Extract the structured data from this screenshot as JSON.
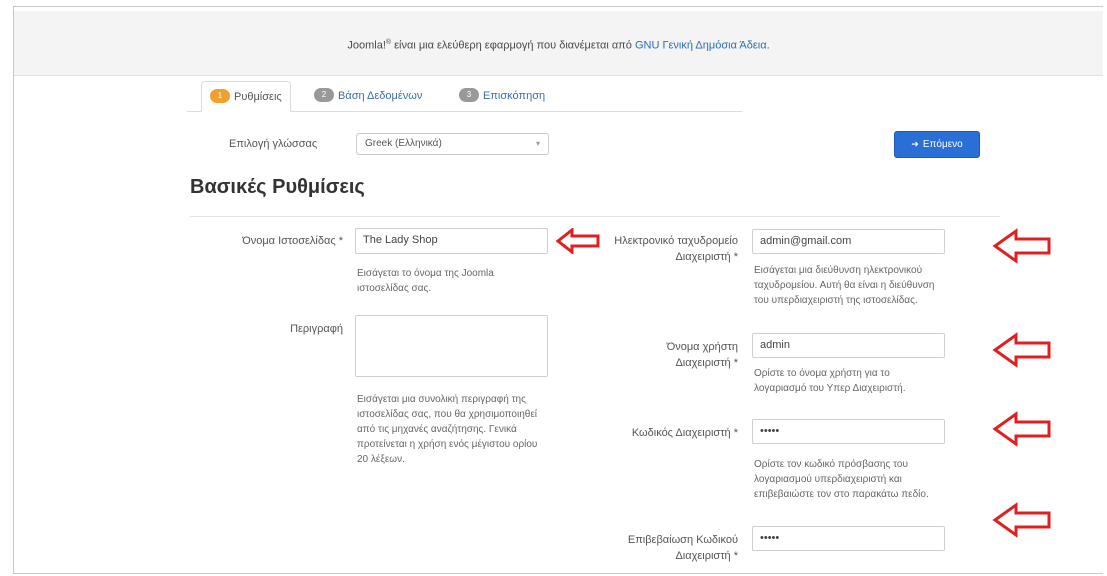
{
  "notice": {
    "brand": "Joomla!",
    "reg": "®",
    "text": " είναι μια ελεύθερη εφαρμογή που διανέμεται από ",
    "link": "GNU Γενική Δημόσια Άδεια",
    "tail": "."
  },
  "tabs": [
    {
      "num": "1",
      "label": "Ρυθμίσεις"
    },
    {
      "num": "2",
      "label": "Βάση Δεδομένων"
    },
    {
      "num": "3",
      "label": "Επισκόπηση"
    }
  ],
  "language": {
    "label": "Επιλογή γλώσσας",
    "value": "Greek (Ελληνικά)",
    "caret": "▾"
  },
  "next_button": {
    "arrow": "➜",
    "label": "Επόμενο"
  },
  "heading": "Βασικές Ρυθμίσεις",
  "left": {
    "site_name": {
      "label": "Όνομα Ιστοσελίδας *",
      "value": "The Lady Shop",
      "help": [
        "Εισάγεται το όνομα της Joomla",
        "ιστοσελίδας σας."
      ]
    },
    "description": {
      "label": "Περιγραφή",
      "value": "",
      "help": [
        "Εισάγεται μια συνολική περιγραφή της",
        "ιστοσελίδας σας, που θα χρησιμοποιηθεί",
        "από τις μηχανές αναζήτησης. Γενικά",
        "προτείνεται η χρήση ενός μέγιστου ορίου",
        "20 λέξεων."
      ]
    }
  },
  "right": {
    "email": {
      "label": [
        "Ηλεκτρονικό ταχυδρομείο",
        "Διαχειριστή *"
      ],
      "value": "admin@gmail.com",
      "help": [
        "Εισάγεται μια διεύθυνση ηλεκτρονικού",
        "ταχυδρομείου. Αυτή θα είναι η διεύθυνση",
        "του υπερδιαχειριστή της ιστοσελίδας."
      ]
    },
    "username": {
      "label": [
        "Όνομα χρήστη",
        "Διαχειριστή *"
      ],
      "value": "admin",
      "help": [
        "Ορίστε το όνομα χρήστη για το",
        "λογαριασμό του Υπερ Διαχειριστή."
      ]
    },
    "password": {
      "label": "Κωδικός Διαχειριστή *",
      "value": "•••••",
      "help": [
        "Ορίστε τον κωδικό πρόσβασης του",
        "λογαριασμού υπερδιαχειριστή και",
        "επιβεβαιώστε τον στο παρακάτω πεδίο."
      ]
    },
    "confirm": {
      "label": [
        "Επιβεβαίωση Κωδικού",
        "Διαχειριστή *"
      ],
      "value": "•••••"
    }
  },
  "annotation_color": "#e02020"
}
